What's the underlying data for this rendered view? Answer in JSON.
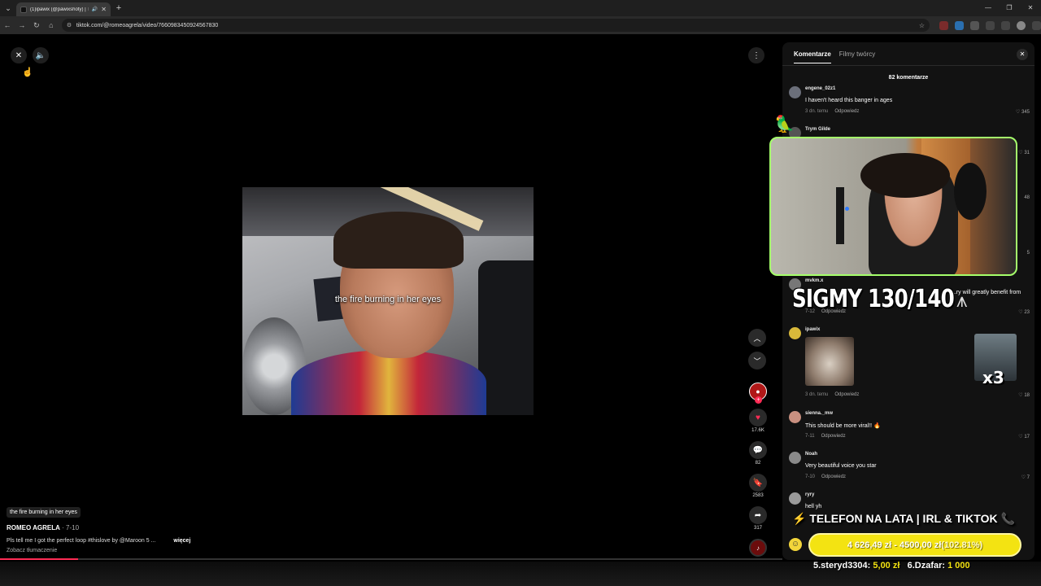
{
  "browser": {
    "tab_title": "(1)ipawix (@pawixshoty) | T",
    "url": "tiktok.com/@romeoagrela/video/7660983450924567830"
  },
  "video": {
    "subtitle": "the fire burning in her eyes",
    "actions": {
      "likes": "17.6K",
      "comments": "82",
      "saves": "2583",
      "shares": "317"
    },
    "caption_chip": "the fire burning in her eyes",
    "author": "ROMEO AGRELA",
    "author_date": " · 7-10",
    "description": "Pls tell me I got the perfect loop #thislove by @Maroon 5 ...",
    "more_label": "więcej",
    "translate_label": "Zobacz tłumaczenie",
    "progress": 0.1
  },
  "comments_panel": {
    "tab_comments": "Komentarze",
    "tab_creator_videos": "Filmy twórcy",
    "count_label": "82 komentarze",
    "items": [
      {
        "user": "engene_02z1",
        "text": "I haven't heard this banger in ages",
        "date": "3 dn. temu",
        "reply": "Odpowiedz",
        "likes": "345"
      },
      {
        "user": "Trym Gilde",
        "text": "",
        "date": "",
        "reply": "",
        "likes": "31"
      },
      {
        "user": "mvkm.x",
        "text": "...ry will greatly benefit from",
        "date": "7-12",
        "reply": "Odpowiedz",
        "likes": "23"
      },
      {
        "user": "ipawix",
        "text": "",
        "date": "3 dn. temu",
        "reply": "Odpowiedz",
        "likes": "18"
      },
      {
        "user": "sienna._mw",
        "text": "This should be more viral!! 🔥",
        "date": "7-11",
        "reply": "Odpowiedz",
        "likes": "17"
      },
      {
        "user": "Noah",
        "text": "Very beautiful voice you star",
        "date": "7-10",
        "reply": "Odpowiedz",
        "likes": "7"
      },
      {
        "user": "ryry",
        "text": "hell yh",
        "date": "",
        "reply": "",
        "likes": ""
      }
    ],
    "hidden_likes": [
      "48",
      "5"
    ]
  },
  "overlay": {
    "sigmy": "SIGMY 130/140",
    "x3": "x3",
    "telefon": "⚡ TELEFON NA LATA | IRL & TIKTOK 📞",
    "goal_text": "4 626,49 zł - 4500,00 zł ",
    "goal_pct": "(102.81%)",
    "donor1_label": "5.steryd3304: ",
    "donor1_amt": "5,00 zł",
    "donor2_label": "6.Dzafar: ",
    "donor2_amt": "1 000"
  },
  "colors": {
    "tiktok_red": "#fe2c55",
    "goal_yellow": "#f3e312",
    "webcam_border": "#a5ff6b"
  }
}
